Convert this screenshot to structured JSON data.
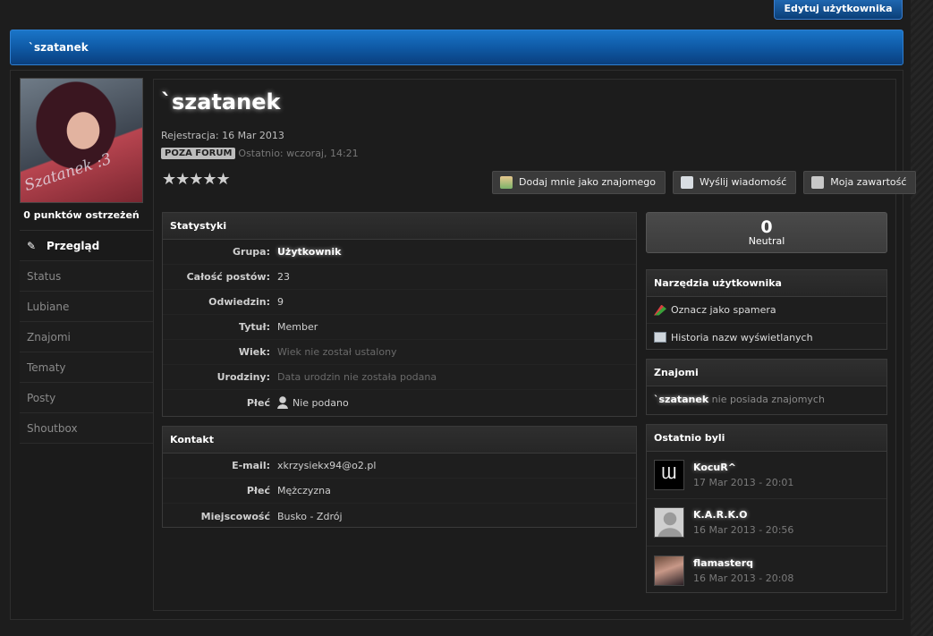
{
  "header": {
    "edit_button": "Edytuj użytkownika",
    "title": "`szatanek"
  },
  "avatar": {
    "signature": "Szatanek :3"
  },
  "warnings": "0 punktów ostrzeżeń",
  "nav": {
    "active": "Przegląd",
    "items": [
      "Status",
      "Lubiane",
      "Znajomi",
      "Tematy",
      "Posty",
      "Shoutbox"
    ]
  },
  "profile": {
    "name": "`szatanek",
    "registration": "Rejestracja: 16 Mar 2013",
    "badge": "POZA FORUM",
    "last_seen": "Ostatnio: wczoraj, 14:21",
    "stars": "★★★★★",
    "rating": 0
  },
  "actions": {
    "add_friend": "Dodaj mnie jako znajomego",
    "send_message": "Wyślij wiadomość",
    "my_content": "Moja zawartość"
  },
  "stats": {
    "title": "Statystyki",
    "rows": [
      {
        "label": "Grupa:",
        "value": "Użytkownik"
      },
      {
        "label": "Całość postów:",
        "value": "23"
      },
      {
        "label": "Odwiedzin:",
        "value": "9"
      },
      {
        "label": "Tytuł:",
        "value": "Member"
      },
      {
        "label": "Wiek:",
        "value": "Wiek nie został ustalony"
      },
      {
        "label": "Urodziny:",
        "value": "Data urodzin nie została podana"
      },
      {
        "label": "Płeć",
        "value": "Nie podano"
      }
    ]
  },
  "contact": {
    "title": "Kontakt",
    "rows": [
      {
        "label": "E-mail:",
        "value": "xkrzysiekx94@o2.pl"
      },
      {
        "label": "Płeć",
        "value": "Mężczyzna"
      },
      {
        "label": "Miejscowość",
        "value": "Busko - Zdrój"
      }
    ]
  },
  "reputation": {
    "value": "0",
    "label": "Neutral"
  },
  "tools": {
    "title": "Narzędzia użytkownika",
    "mark_spammer": "Oznacz jako spamera",
    "name_history": "Historia nazw wyświetlanych"
  },
  "friends": {
    "title": "Znajomi",
    "name": "`szatanek",
    "text": " nie posiada znajomych"
  },
  "recent": {
    "title": "Ostatnio byli",
    "visitors": [
      {
        "name": "KocuR^",
        "date": "17 Mar 2013 - 20:01"
      },
      {
        "name": "K.A.R.K.O",
        "date": "16 Mar 2013 - 20:56"
      },
      {
        "name": "flamasterq",
        "date": "16 Mar 2013 - 20:08"
      }
    ]
  }
}
